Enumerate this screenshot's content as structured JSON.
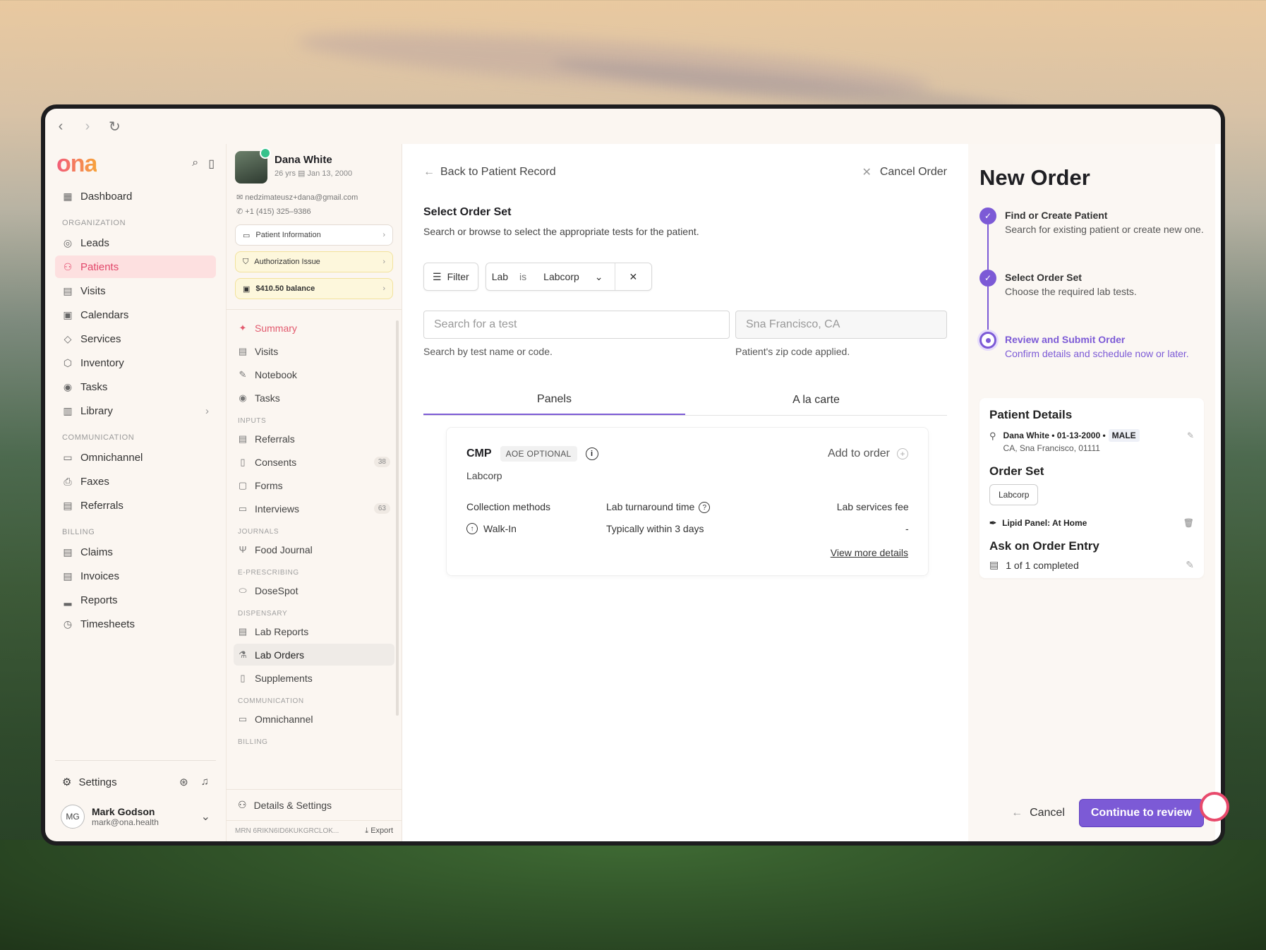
{
  "app": {
    "logo": "ona"
  },
  "sidebar": {
    "dashboard": "Dashboard",
    "sections": {
      "organization": "ORGANIZATION",
      "communication": "COMMUNICATION",
      "billing": "BILLING"
    },
    "org_items": [
      {
        "label": "Leads",
        "icon": "target-icon"
      },
      {
        "label": "Patients",
        "icon": "users-icon"
      },
      {
        "label": "Visits",
        "icon": "calendar-icon"
      },
      {
        "label": "Calendars",
        "icon": "calendars-icon"
      },
      {
        "label": "Services",
        "icon": "tag-icon"
      },
      {
        "label": "Inventory",
        "icon": "box-icon"
      },
      {
        "label": "Tasks",
        "icon": "check-circle-icon"
      },
      {
        "label": "Library",
        "icon": "book-icon"
      }
    ],
    "comm_items": [
      {
        "label": "Omnichannel",
        "icon": "chat-icon"
      },
      {
        "label": "Faxes",
        "icon": "printer-icon"
      },
      {
        "label": "Referrals",
        "icon": "doc-icon"
      }
    ],
    "billing_items": [
      {
        "label": "Claims",
        "icon": "doc-icon"
      },
      {
        "label": "Invoices",
        "icon": "doc-icon"
      },
      {
        "label": "Reports",
        "icon": "chart-icon"
      },
      {
        "label": "Timesheets",
        "icon": "clock-icon"
      }
    ],
    "settings": "Settings",
    "user": {
      "initials": "MG",
      "name": "Mark Godson",
      "email": "mark@ona.health"
    }
  },
  "patient": {
    "name": "Dana White",
    "age": "26 yrs",
    "dob": "Jan 13, 2000",
    "email": "nedzimateusz+dana@gmail.com",
    "phone": "+1 (415) 325–9386",
    "cards": {
      "info": "Patient Information",
      "auth": "Authorization Issue",
      "balance": "$410.50 balance"
    },
    "nav": {
      "summary": "Summary",
      "visits": "Visits",
      "notebook": "Notebook",
      "tasks": "Tasks",
      "inputs": "INPUTS",
      "referrals": "Referrals",
      "consents": "Consents",
      "consents_count": "38",
      "forms": "Forms",
      "interviews": "Interviews",
      "interviews_count": "63",
      "journals": "JOURNALS",
      "food_journal": "Food Journal",
      "eprescribing": "E-PRESCRIBING",
      "dosespot": "DoseSpot",
      "dispensary": "DISPENSARY",
      "lab_reports": "Lab Reports",
      "lab_orders": "Lab Orders",
      "supplements": "Supplements",
      "communication": "COMMUNICATION",
      "omnichannel": "Omnichannel",
      "billing": "BILLING"
    },
    "details_settings": "Details & Settings",
    "mrn": "MRN 6RIKN6ID6KUKGRCLOK...",
    "export": "Export"
  },
  "main": {
    "back": "Back to Patient Record",
    "cancel_order": "Cancel Order",
    "title": "Select Order Set",
    "subtitle": "Search or browse to select the appropriate tests for the patient.",
    "filter": "Filter",
    "chip": {
      "field": "Lab",
      "op": "is",
      "value": "Labcorp"
    },
    "search_placeholder": "Search for a test",
    "search_hint": "Search by test name or code.",
    "location_value": "Sna Francisco, CA",
    "location_hint": "Patient's zip code applied.",
    "tabs": [
      "Panels",
      "A la carte"
    ],
    "panel": {
      "name": "CMP",
      "badge": "AOE OPTIONAL",
      "add": "Add to order",
      "lab": "Labcorp",
      "col1_h": "Collection methods",
      "col2_h": "Lab turnaround time",
      "col3_h": "Lab services fee",
      "col1_v": "Walk-In",
      "col2_v": "Typically within 3 days",
      "col3_v": "-",
      "more": "View more details"
    }
  },
  "order": {
    "title": "New Order",
    "steps": [
      {
        "title": "Find or Create Patient",
        "desc": "Search for existing patient or create new one."
      },
      {
        "title": "Select Order Set",
        "desc": "Choose the required lab tests."
      },
      {
        "title": "Review and Submit Order",
        "desc": "Confirm details and schedule now or later."
      }
    ],
    "details": {
      "heading": "Patient Details",
      "person": "Dana White • 01-13-2000 •",
      "sex": "MALE",
      "address": "CA, Sna Francisco, 01111",
      "order_set_h": "Order Set",
      "lab": "Labcorp",
      "kit": "Lipid Panel: At Home",
      "ask_h": "Ask on Order Entry",
      "ask_status": "1 of 1 completed"
    },
    "cancel": "Cancel",
    "continue": "Continue to review"
  }
}
